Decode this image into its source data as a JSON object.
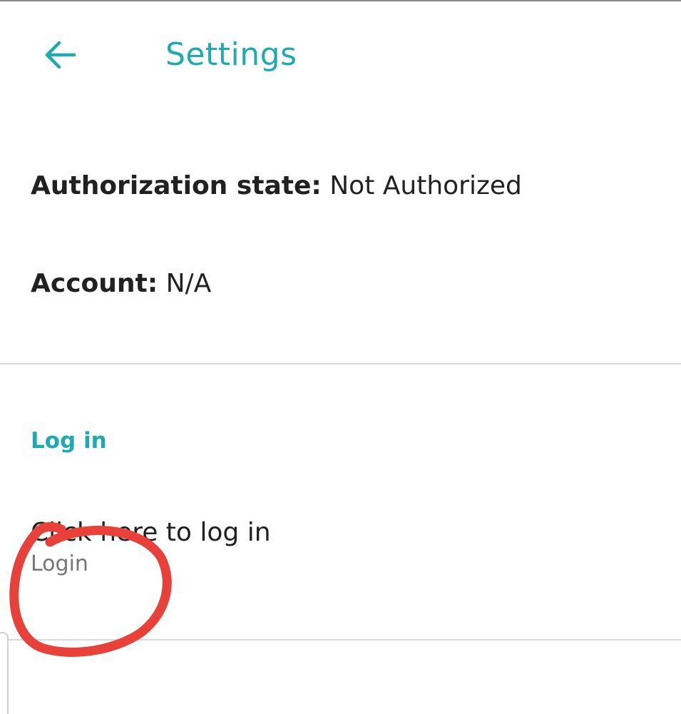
{
  "app_bar": {
    "back_icon": "arrow-back-icon",
    "title": "Settings"
  },
  "info": {
    "auth_label": "Authorization state:",
    "auth_value": "Not Authorized",
    "account_label": "Account:",
    "account_value": "N/A"
  },
  "login_section": {
    "header": "Log in",
    "item_title": "Click here to log in",
    "item_summary": "Login"
  },
  "annotation": {
    "shape": "hand-drawn-circle",
    "color": "#e8413a"
  },
  "colors": {
    "accent": "#1faab0",
    "text_primary": "#212121",
    "text_secondary": "#757575",
    "divider": "#d9d9d9"
  }
}
